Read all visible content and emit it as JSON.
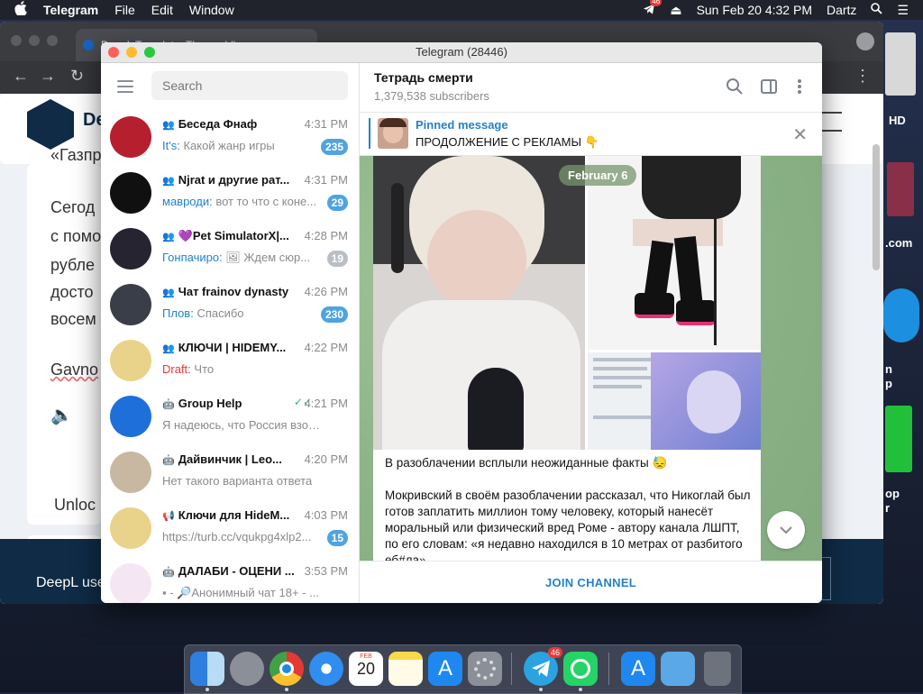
{
  "menubar": {
    "apple_icon": "",
    "app": "Telegram",
    "items": [
      "File",
      "Edit",
      "Window"
    ],
    "telegram_badge": "46",
    "clock": "Sun Feb 20  4:32 PM",
    "user": "Dartz"
  },
  "browser": {
    "tab_title": "DeepL Translate: The world's",
    "logo_text": "De",
    "lines": [
      "«Газпр",
      "Сегод",
      "с помо",
      "рубле",
      "досто",
      "восем",
      "Gavno"
    ],
    "unlock_text": "Unloc",
    "banner_text": "DeepL use"
  },
  "desktop_side_labels": [
    "HD",
    ".com",
    "n",
    "p",
    "op",
    "r"
  ],
  "telegram": {
    "window_title": "Telegram (28446)",
    "search_placeholder": "Search",
    "chats": [
      {
        "name": "Беседа Фнаф",
        "type_icon": "group",
        "time": "4:31 PM",
        "sender": "It's:",
        "preview": " Какой жанр игры",
        "badge": "235",
        "badge_color": "#4fa3e0",
        "avatar_color": "#b51f2e",
        "draft": false,
        "read_ticks": ""
      },
      {
        "name": "Njrat и другие рат...",
        "type_icon": "group",
        "time": "4:31 PM",
        "sender": "мавроди:",
        "preview": " вот то что с коне...",
        "badge": "29",
        "badge_color": "#4fa3e0",
        "avatar_color": "#101010",
        "draft": false,
        "read_ticks": ""
      },
      {
        "name": "💜Pet SimulatorX|...",
        "type_icon": "group",
        "time": "4:28 PM",
        "sender": "Гонпачиро:",
        "preview": " 🖼 Ждем сюр...",
        "badge": "19",
        "badge_color": "#b9bec4",
        "avatar_color": "#262431",
        "draft": false,
        "read_ticks": ""
      },
      {
        "name": "Чат frainov dynasty",
        "type_icon": "group",
        "time": "4:26 PM",
        "sender": "Плов:",
        "preview": " Спасибо",
        "badge": "230",
        "badge_color": "#4fa3e0",
        "avatar_color": "#3a3e48",
        "draft": false,
        "read_ticks": ""
      },
      {
        "name": "КЛЮЧИ | HIDEMY...",
        "type_icon": "group",
        "time": "4:22 PM",
        "sender": "Draft:",
        "preview": " Что",
        "badge": "",
        "badge_color": "",
        "avatar_color": "#e9d28a",
        "draft": true,
        "read_ticks": ""
      },
      {
        "name": "Group Help",
        "type_icon": "bot",
        "time": "4:21 PM",
        "sender": "",
        "preview": "Я надеюсь, что Россия взорвет...",
        "badge": "",
        "badge_color": "",
        "avatar_color": "#1e6fd9",
        "draft": false,
        "read_ticks": "✓✓"
      },
      {
        "name": "Дайвинчик | Leo...",
        "type_icon": "bot",
        "time": "4:20 PM",
        "sender": "",
        "preview": "Нет такого варианта ответа",
        "badge": "",
        "badge_color": "",
        "avatar_color": "#c8b8a2",
        "draft": false,
        "read_ticks": ""
      },
      {
        "name": "Ключи для HideM...",
        "type_icon": "channel",
        "time": "4:03 PM",
        "sender": "",
        "preview": "https://turb.cc/vqukpg4xlp2...",
        "badge": "15",
        "badge_color": "#4fa3e0",
        "avatar_color": "#e9d28a",
        "draft": false,
        "read_ticks": ""
      },
      {
        "name": "ДАЛАБИ - ОЦЕНИ ...",
        "type_icon": "bot",
        "time": "3:53 PM",
        "sender": "",
        "preview": "▪ - 🔎Анонимный чат 18+ - ...",
        "badge": "",
        "badge_color": "",
        "avatar_color": "#f4e6f2",
        "draft": false,
        "read_ticks": ""
      }
    ],
    "channel": {
      "title": "Тетрадь смерти",
      "subscribers": "1,379,538 subscribers"
    },
    "pinned": {
      "label": "Pinned message",
      "text": "ПРОДОЛЖЕНИЕ С РЕКЛАМЫ 👇"
    },
    "date_pill": "February 6",
    "message": {
      "p1": "В разоблачении всплыли неожиданные факты 😓",
      "p2": "Мокривский в своём разоблачении рассказал, что Никоглай был готов заплатить миллион тому человеку, который нанесёт моральный или физический вред Роме - автору канала ЛШПТ, по его словам: «я недавно находился в 10 метрах от разбитого еб#ла»"
    },
    "join_label": "JOIN CHANNEL"
  },
  "dock": {
    "apps": [
      "finder",
      "launchpad",
      "chrome",
      "safari",
      "calendar",
      "notes",
      "app-store",
      "system-preferences",
      "telegram",
      "whatsapp",
      "app-store-2",
      "downloads-folder",
      "trash"
    ],
    "calendar": {
      "month": "FEB",
      "day": "20"
    },
    "telegram_badge": "46"
  },
  "colors": {
    "accent": "#2481cc",
    "unread_badge": "#4fa3e0",
    "muted_badge": "#b9bec4",
    "draft": "#e53935",
    "chat_bg": "#8fb58a"
  }
}
